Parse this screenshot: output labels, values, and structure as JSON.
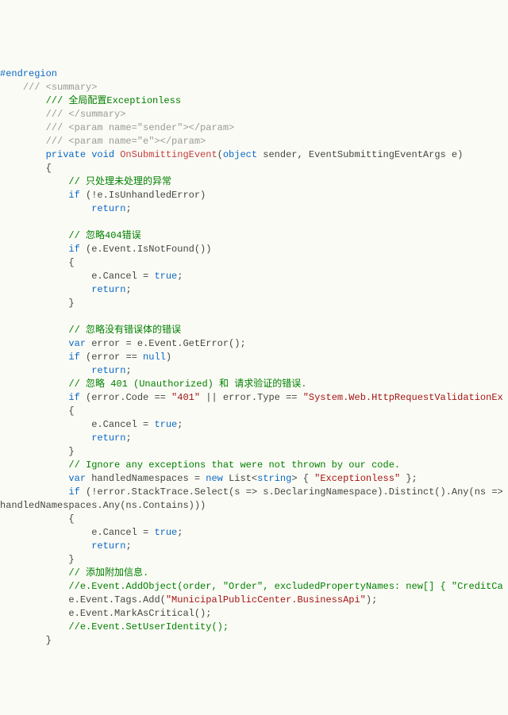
{
  "lines": [
    {
      "cls": "dir",
      "pad": 0,
      "text": "#endregion"
    },
    {
      "cls": "",
      "pad": 0,
      "text": ""
    },
    {
      "cls": "",
      "pad": 0,
      "text": ""
    },
    {
      "cls": "cmtg",
      "pad": 4,
      "text": "/// <summary>"
    },
    {
      "cls": "cmt",
      "pad": 8,
      "text": "/// 全局配置Exceptionless"
    },
    {
      "cls": "cmtg",
      "pad": 8,
      "text": "/// </summary>"
    },
    {
      "cls": "cmtg",
      "pad": 8,
      "text": "/// <param name=\"sender\"></param>"
    },
    {
      "cls": "cmtg",
      "pad": 8,
      "text": "/// <param name=\"e\"></param>"
    },
    {
      "cls": "sig",
      "pad": 8,
      "text": ""
    },
    {
      "cls": "",
      "pad": 8,
      "text": "{"
    },
    {
      "cls": "cmt",
      "pad": 12,
      "text": "// 只处理未处理的异常"
    },
    {
      "cls": "ifu",
      "pad": 12,
      "text": ""
    },
    {
      "cls": "ret",
      "pad": 16,
      "text": ""
    },
    {
      "cls": "",
      "pad": 12,
      "text": ""
    },
    {
      "cls": "cmt",
      "pad": 12,
      "text": "// 忽略404错误"
    },
    {
      "cls": "ifnf",
      "pad": 12,
      "text": ""
    },
    {
      "cls": "",
      "pad": 12,
      "text": "{"
    },
    {
      "cls": "canc",
      "pad": 16,
      "text": ""
    },
    {
      "cls": "ret",
      "pad": 16,
      "text": ""
    },
    {
      "cls": "",
      "pad": 12,
      "text": "}"
    },
    {
      "cls": "",
      "pad": 12,
      "text": ""
    },
    {
      "cls": "cmt",
      "pad": 12,
      "text": "// 忽略没有错误体的错误"
    },
    {
      "cls": "verr",
      "pad": 12,
      "text": ""
    },
    {
      "cls": "ifen",
      "pad": 12,
      "text": ""
    },
    {
      "cls": "ret",
      "pad": 16,
      "text": ""
    },
    {
      "cls": "cmt",
      "pad": 12,
      "text": "// 忽略 401 (Unauthorized) 和 请求验证的错误."
    },
    {
      "cls": "if401",
      "pad": 12,
      "text": ""
    },
    {
      "cls": "",
      "pad": 12,
      "text": "{"
    },
    {
      "cls": "canc",
      "pad": 16,
      "text": ""
    },
    {
      "cls": "ret",
      "pad": 16,
      "text": ""
    },
    {
      "cls": "",
      "pad": 12,
      "text": "}"
    },
    {
      "cls": "cmt",
      "pad": 12,
      "text": "// Ignore any exceptions that were not thrown by our code."
    },
    {
      "cls": "vhn",
      "pad": 12,
      "text": ""
    },
    {
      "cls": "ifst",
      "pad": 12,
      "text": ""
    },
    {
      "cls": "",
      "pad": 0,
      "text": "handledNamespaces.Any(ns.Contains)))"
    },
    {
      "cls": "",
      "pad": 12,
      "text": "{"
    },
    {
      "cls": "canc",
      "pad": 16,
      "text": ""
    },
    {
      "cls": "ret",
      "pad": 16,
      "text": ""
    },
    {
      "cls": "",
      "pad": 12,
      "text": "}"
    },
    {
      "cls": "cmt",
      "pad": 12,
      "text": "// 添加附加信息."
    },
    {
      "cls": "cadd",
      "pad": 12,
      "text": ""
    },
    {
      "cls": "ctag",
      "pad": 12,
      "text": ""
    },
    {
      "cls": "",
      "pad": 12,
      "text": "e.Event.MarkAsCritical();"
    },
    {
      "cls": "cmt",
      "pad": 12,
      "text": "//e.Event.SetUserIdentity();"
    },
    {
      "cls": "",
      "pad": 8,
      "text": "}"
    }
  ],
  "sig": {
    "private": "private",
    "void": "void",
    "fn": "OnSubmittingEvent",
    "obj": "object",
    "sender": " sender, EventSubmittingEventArgs e)"
  },
  "kw": {
    "if": "if",
    "return": "return",
    "var": "var",
    "null": "null",
    "new": "new",
    "true": "true"
  },
  "ifu": " (!e.IsUnhandledError)",
  "ifnf": " (e.Event.IsNotFound())",
  "verr": " error = e.Event.GetError();",
  "ifen_a": " (error == ",
  "ifen_b": ")",
  "if401_a": " (error.Code == ",
  "if401_s1": "\"401\"",
  "if401_b": " || error.Type == ",
  "if401_s2": "\"System.Web.HttpRequestValidationEx",
  "canc_a": "e.Cancel = ",
  "canc_b": ";",
  "ret_b": ";",
  "vhn_a": " handledNamespaces = ",
  "vhn_b": " List<",
  "vhn_c": "string",
  "vhn_d": "> { ",
  "vhn_s": "\"Exceptionless\"",
  "vhn_e": " };",
  "ifst": " (!error.StackTrace.Select(s => s.DeclaringNamespace).Distinct().Any(ns =>",
  "cadd_a": "//e.Event.AddObject(order, \"Order\", excludedPropertyNames: new[] { \"CreditCa",
  "ctag_a": "e.Event.Tags.Add(",
  "ctag_s": "\"MunicipalPublicCenter.BusinessApi\"",
  "ctag_b": ");"
}
